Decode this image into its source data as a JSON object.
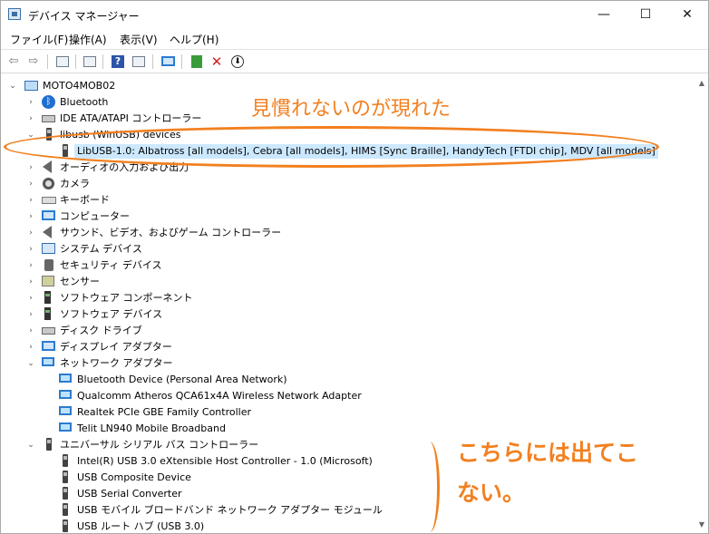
{
  "window": {
    "title": "デバイス マネージャー",
    "controls": {
      "minimize": "—",
      "maximize": "☐",
      "close": "✕"
    }
  },
  "menu": [
    "ファイル(F)",
    "操作(A)",
    "表示(V)",
    "ヘルプ(H)"
  ],
  "toolbar": {
    "back": "⇦",
    "forward": "⇨",
    "help": "?",
    "remove": "✕",
    "download": "⬇"
  },
  "tree": {
    "root": "MOTO4MOB02",
    "expander_collapsed": "›",
    "expander_expanded": "⌄",
    "categories": [
      {
        "label": "Bluetooth",
        "bt_glyph": "ᛒ"
      },
      {
        "label": "IDE ATA/ATAPI コントローラー"
      },
      {
        "label": "libusb (WinUSB) devices"
      },
      {
        "label": "LibUSB-1.0: Albatross [all models], Cebra [all models], HIMS [Sync Braille], HandyTech [FTDI chip], MDV [all models]"
      },
      {
        "label": "オーディオの入力および出力"
      },
      {
        "label": "カメラ"
      },
      {
        "label": "キーボード"
      },
      {
        "label": "コンピューター"
      },
      {
        "label": "サウンド、ビデオ、およびゲーム コントローラー"
      },
      {
        "label": "システム デバイス"
      },
      {
        "label": "セキュリティ デバイス"
      },
      {
        "label": "センサー"
      },
      {
        "label": "ソフトウェア コンポーネント"
      },
      {
        "label": "ソフトウェア デバイス"
      },
      {
        "label": "ディスク ドライブ"
      },
      {
        "label": "ディスプレイ アダプター"
      },
      {
        "label": "ネットワーク アダプター"
      },
      {
        "label": "Bluetooth Device (Personal Area Network)"
      },
      {
        "label": "Qualcomm Atheros QCA61x4A Wireless Network Adapter"
      },
      {
        "label": "Realtek PCIe GBE Family Controller"
      },
      {
        "label": "Telit LN940 Mobile Broadband"
      },
      {
        "label": "ユニバーサル シリアル バス コントローラー"
      },
      {
        "label": "Intel(R) USB 3.0 eXtensible Host Controller - 1.0 (Microsoft)"
      },
      {
        "label": "USB Composite Device"
      },
      {
        "label": "USB Serial Converter"
      },
      {
        "label": "USB モバイル ブロードバンド ネットワーク アダプター モジュール"
      },
      {
        "label": "USB ルート ハブ (USB 3.0)"
      }
    ]
  },
  "scrollbar": {
    "up": "▲",
    "down": "▼"
  },
  "annotations": {
    "top": "見慣れないのが現れた",
    "bottom": "こちらには出てこない。",
    "color": "#f28020"
  }
}
